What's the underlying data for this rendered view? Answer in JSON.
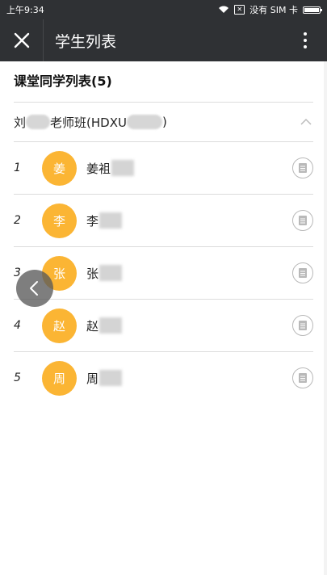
{
  "status_bar": {
    "time": "上午9:34",
    "carrier": "没有 SIM 卡"
  },
  "header": {
    "title": "学生列表"
  },
  "section": {
    "title": "课堂同学列表(5)"
  },
  "class_info": {
    "prefix": "刘",
    "middle": "老师班(HDXU",
    "suffix": ")"
  },
  "students": [
    {
      "index": "1",
      "avatar": "姜",
      "name": "姜袓"
    },
    {
      "index": "2",
      "avatar": "李",
      "name": "李"
    },
    {
      "index": "3",
      "avatar": "张",
      "name": "张"
    },
    {
      "index": "4",
      "avatar": "赵",
      "name": "赵"
    },
    {
      "index": "5",
      "avatar": "周",
      "name": "周"
    }
  ],
  "colors": {
    "header_bg": "#2f3134",
    "avatar_bg": "#fbb534",
    "divider": "#dcdcdc"
  },
  "icons": {
    "close": "close-icon",
    "more": "more-vertical-icon",
    "collapse": "chevron-up-icon",
    "report": "report-icon",
    "back": "chevron-left-icon"
  }
}
